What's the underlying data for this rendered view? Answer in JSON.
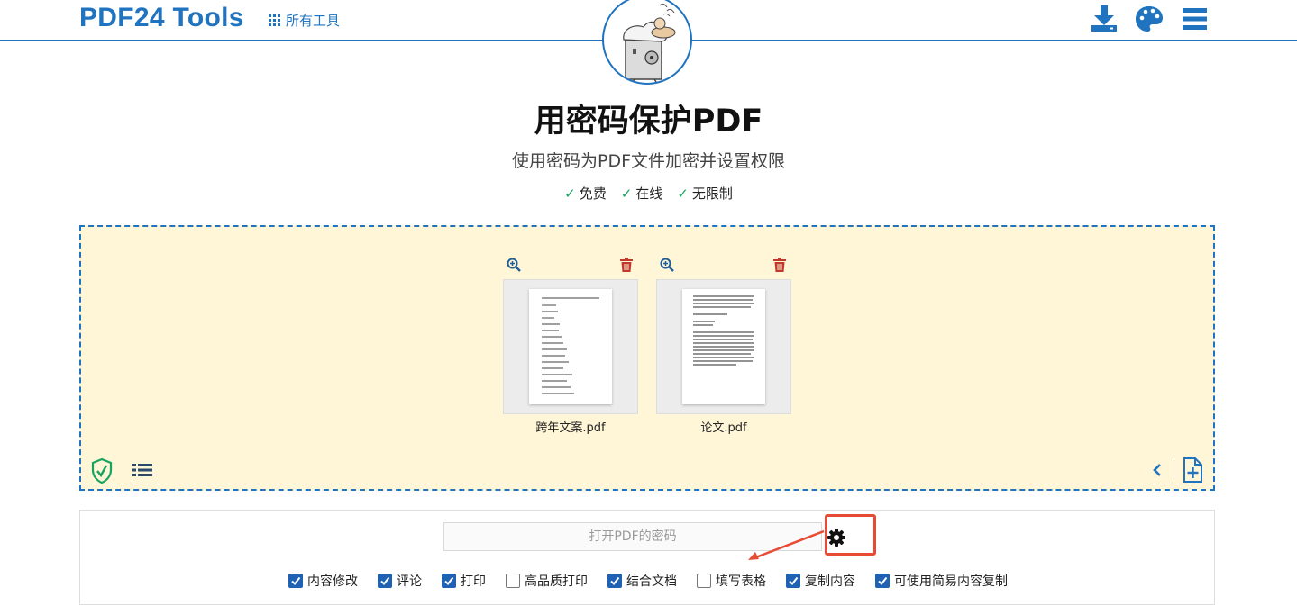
{
  "header": {
    "logo": "PDF24 Tools",
    "all_tools": "所有工具"
  },
  "main": {
    "title": "用密码保护PDF",
    "subtitle": "使用密码为PDF文件加密并设置权限",
    "features": [
      "免费",
      "在线",
      "无限制"
    ]
  },
  "files": [
    {
      "name": "跨年文案.pdf"
    },
    {
      "name": "论文.pdf"
    }
  ],
  "options": {
    "password_placeholder": "打开PDF的密码",
    "permissions": [
      {
        "label": "内容修改",
        "checked": true
      },
      {
        "label": "评论",
        "checked": true
      },
      {
        "label": "打印",
        "checked": true
      },
      {
        "label": "高品质打印",
        "checked": false
      },
      {
        "label": "结合文档",
        "checked": true
      },
      {
        "label": "填写表格",
        "checked": false
      },
      {
        "label": "复制内容",
        "checked": true
      },
      {
        "label": "可使用简易内容复制",
        "checked": true
      }
    ]
  },
  "colors": {
    "brand": "#1f73bf",
    "dropzone_bg": "#fff5d7",
    "checkbox_on": "#1f62b3",
    "trash": "#c0392b",
    "shield": "#1aa260",
    "annotation": "#e84b35"
  },
  "icons": [
    "grid-icon",
    "download-icon",
    "palette-icon",
    "menu-icon",
    "zoom-in-icon",
    "trash-icon",
    "shield-check-icon",
    "list-icon",
    "chevron-left-icon",
    "add-file-icon",
    "gear-icon"
  ]
}
